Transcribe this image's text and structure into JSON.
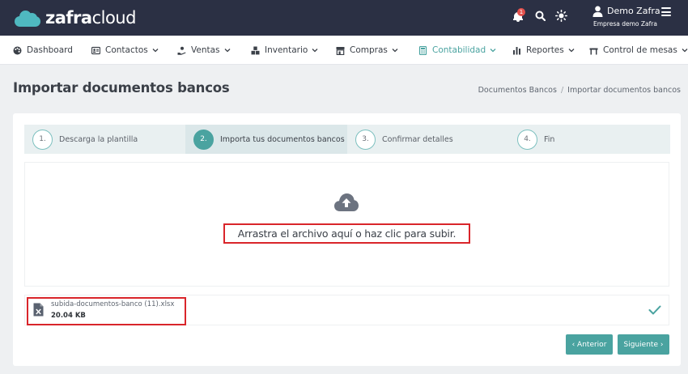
{
  "header": {
    "logo_bold": "zafra",
    "logo_light": "cloud",
    "notification_count": "1",
    "user_name": "Demo Zafra",
    "company": "Empresa demo Zafra"
  },
  "nav": [
    {
      "label": "Dashboard",
      "icon": "palette-icon"
    },
    {
      "label": "Contactos",
      "icon": "contacts-card-icon"
    },
    {
      "label": "Ventas",
      "icon": "hand-coin-icon"
    },
    {
      "label": "Inventario",
      "icon": "boxes-icon"
    },
    {
      "label": "Compras",
      "icon": "store-icon"
    },
    {
      "label": "Contabilidad",
      "icon": "calculator-icon",
      "active": true
    },
    {
      "label": "Reportes",
      "icon": "bar-chart-icon"
    },
    {
      "label": "Control de mesas",
      "icon": "table-icon"
    }
  ],
  "page": {
    "title": "Importar documentos bancos",
    "breadcrumb": [
      "Documentos Bancos",
      "Importar documentos bancos"
    ]
  },
  "wizard": {
    "steps": [
      {
        "num": "1.",
        "label": "Descarga la plantilla"
      },
      {
        "num": "2.",
        "label": "Importa tus documentos bancos",
        "active": true
      },
      {
        "num": "3.",
        "label": "Confirmar detalles"
      },
      {
        "num": "4.",
        "label": "Fin"
      }
    ]
  },
  "dropzone": {
    "text": "Arrastra el archivo aquí o haz clic para subir."
  },
  "file": {
    "name": "subida-documentos-banco (11).xlsx",
    "size": "20.04 KB"
  },
  "buttons": {
    "prev": "‹ Anterior",
    "next": "Siguiente ›"
  },
  "colors": {
    "header_bg": "#2b3044",
    "accent": "#4aa3a0",
    "highlight": "#d9252a"
  }
}
